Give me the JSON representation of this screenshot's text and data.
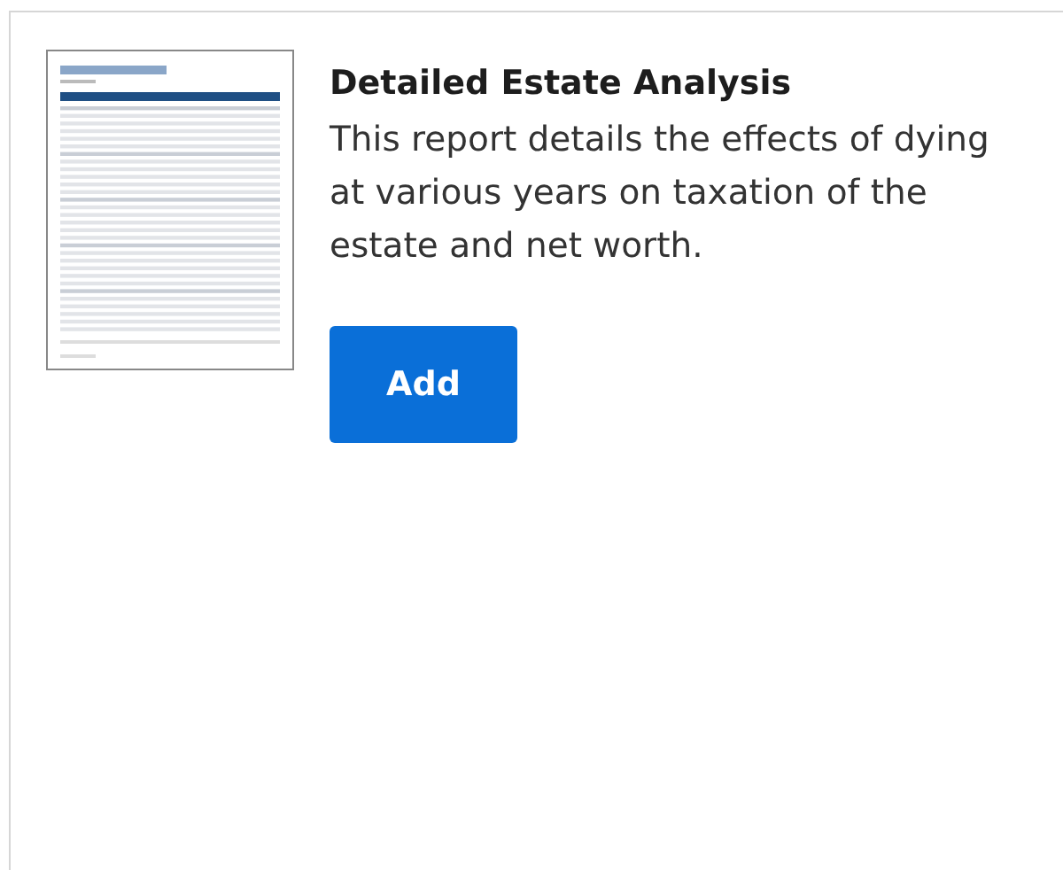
{
  "report": {
    "title": "Detailed Estate Analysis",
    "description": "This report details the effects of dying at various years on taxation of the estate and net worth.",
    "button": "Add"
  }
}
